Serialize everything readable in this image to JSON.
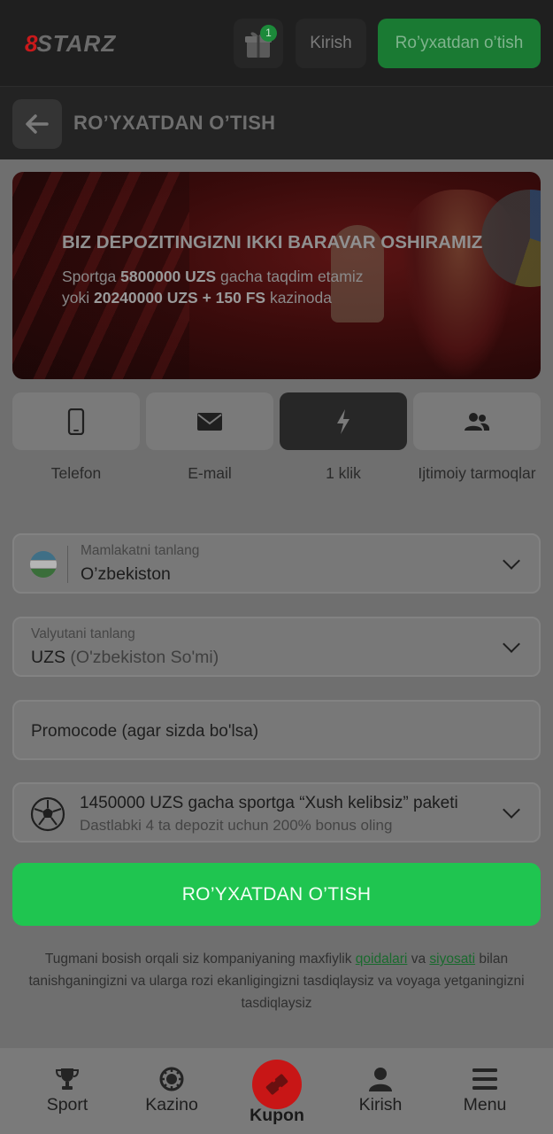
{
  "header": {
    "logo_prefix": "8",
    "logo_text": "STARZ",
    "gift_badge_count": "1",
    "login_label": "Kirish",
    "register_label": "Ro’yxatdan o’tish"
  },
  "subheader": {
    "title": "RO’YXATDAN O’TISH"
  },
  "banner": {
    "headline": "BIZ DEPOZITINGIZNI IKKI BARAVAR OSHIRAMIZ",
    "line1_pre": "Sportga ",
    "line1_bold": "5800000 UZS",
    "line1_post": " gacha taqdim etamiz",
    "line2_pre": "yoki ",
    "line2_bold": "20240000 UZS + 150 FS",
    "line2_post": " kazinoda"
  },
  "methods": [
    {
      "label": "Telefon",
      "icon": "phone-icon",
      "active": false
    },
    {
      "label": "E-mail",
      "icon": "envelope-icon",
      "active": false
    },
    {
      "label": "1 klik",
      "icon": "lightning-icon",
      "active": true
    },
    {
      "label": "Ijtimoiy tarmoqlar",
      "icon": "users-icon",
      "active": false
    }
  ],
  "country": {
    "label": "Mamlakatni tanlang",
    "value": "O’zbekiston",
    "flag_icon": "uzbekistan-flag-icon"
  },
  "currency": {
    "label": "Valyutani tanlang",
    "code": "UZS",
    "name": "(O'zbekiston So'mi)"
  },
  "promocode": {
    "placeholder": "Promocode (agar sizda bo'lsa)"
  },
  "bonus": {
    "title": "1450000 UZS gacha sportga “Xush kelibsiz” paketi",
    "subtitle": "Dastlabki 4 ta depozit uchun 200% bonus oling",
    "icon": "soccer-ball-icon"
  },
  "submit_label": "RO’YXATDAN O’TISH",
  "terms": {
    "part1": "Tugmani bosish orqali siz kompaniyaning maxfiylik ",
    "link1": "qoidalari",
    "part2": " va ",
    "link2": "siyosati",
    "part3": " bilan tanishganingizni va ularga rozi ekanligingizni tasdiqlaysiz va voyaga yetganingizni tasdiqlaysiz"
  },
  "bottom_nav": [
    {
      "label": "Sport",
      "icon": "trophy-icon"
    },
    {
      "label": "Kazino",
      "icon": "casino-chip-icon"
    },
    {
      "label": "Kupon",
      "icon": "ticket-icon"
    },
    {
      "label": "Kirish",
      "icon": "user-icon"
    },
    {
      "label": "Menu",
      "icon": "hamburger-icon"
    }
  ],
  "colors": {
    "brand_red": "#c8191b",
    "cta_green": "#1fc550",
    "register_green": "#1a7a33",
    "link_green": "#1a6a2e"
  }
}
